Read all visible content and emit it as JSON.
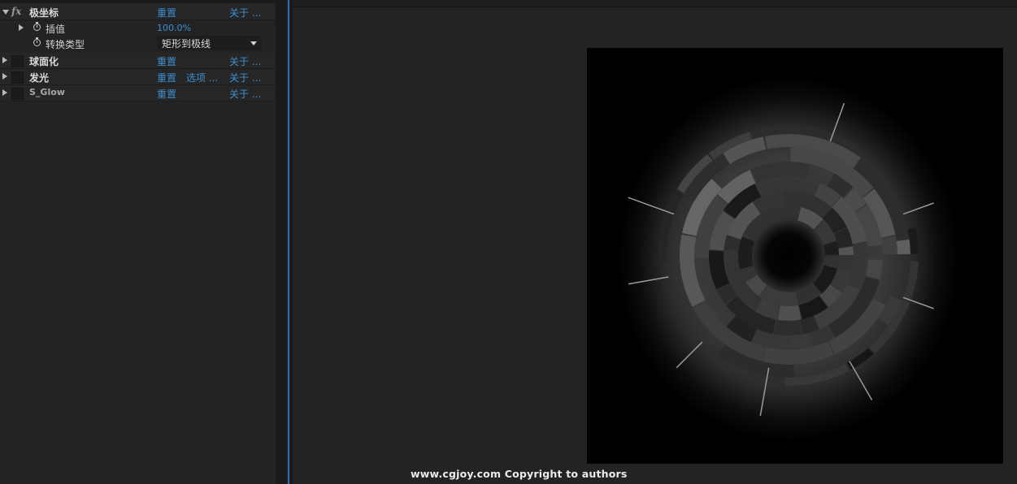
{
  "effect_controls": {
    "effects": [
      {
        "name": "极坐标",
        "expanded": true,
        "reset_label": "重置",
        "about_label": "关于 ...",
        "properties": [
          {
            "label": "插值",
            "value": "100.0%"
          },
          {
            "label": "转换类型",
            "value": "矩形到极线"
          }
        ]
      },
      {
        "name": "球面化",
        "reset_label": "重置",
        "about_label": "关于 ..."
      },
      {
        "name": "发光",
        "reset_label": "重置",
        "options_label": "选项 ...",
        "about_label": "关于 ..."
      },
      {
        "name": "S_Glow",
        "reset_label": "重置",
        "about_label": "关于 ..."
      }
    ]
  },
  "viewer": {
    "watermark": "www.cgjoy.com Copyright to authors"
  },
  "colors": {
    "link_blue": "#3e8ed0",
    "panel_bg": "#232323",
    "divider_blue": "#2d6fb5"
  }
}
